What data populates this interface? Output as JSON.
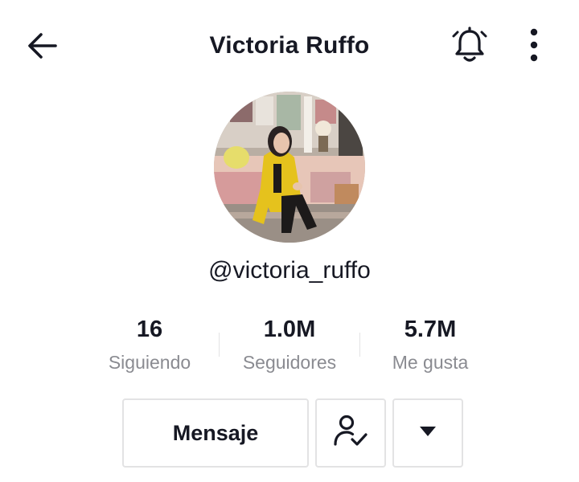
{
  "header": {
    "title": "Victoria Ruffo",
    "back_icon": "arrow-left-icon",
    "bell_icon": "bell-icon",
    "more_icon": "more-vertical-icon"
  },
  "profile": {
    "username": "@victoria_ruffo",
    "avatar": "profile-photo"
  },
  "stats": [
    {
      "value": "16",
      "label": "Siguiendo"
    },
    {
      "value": "1.0M",
      "label": "Seguidores"
    },
    {
      "value": "5.7M",
      "label": "Me gusta"
    }
  ],
  "actions": {
    "message_label": "Mensaje",
    "following_icon": "user-check-icon",
    "dropdown_icon": "caret-down-icon"
  },
  "colors": {
    "text_primary": "#161823",
    "text_secondary": "#8a8b91",
    "border": "#e3e3e4"
  }
}
